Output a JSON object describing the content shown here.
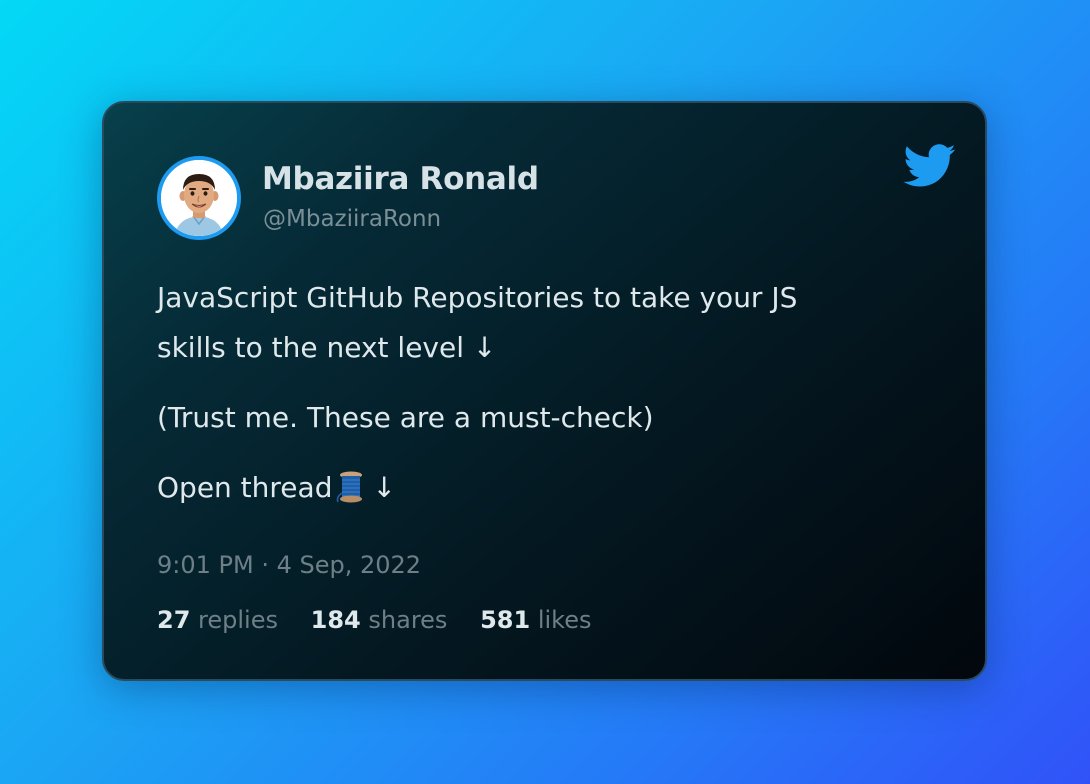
{
  "author": {
    "name": "Mbaziira Ronald",
    "handle": "@MbaziiraRonn"
  },
  "tweet": {
    "line1": "JavaScript GitHub Repositories to take your JS",
    "line2": "skills to the next level ↓",
    "line3": "(Trust me. These are a must-check)",
    "line4_prefix": "Open thread",
    "line4_suffix": "↓",
    "emoji": "spool-of-thread-icon"
  },
  "timestamp": "9:01 PM · 4 Sep, 2022",
  "stats": {
    "replies_count": "27",
    "replies_label": "replies",
    "shares_count": "184",
    "shares_label": "shares",
    "likes_count": "581",
    "likes_label": "likes"
  },
  "colors": {
    "twitter_blue": "#1d9bf0",
    "card_background": "#041821",
    "page_gradient_start": "#03d8f6",
    "page_gradient_end": "#3152f8"
  }
}
